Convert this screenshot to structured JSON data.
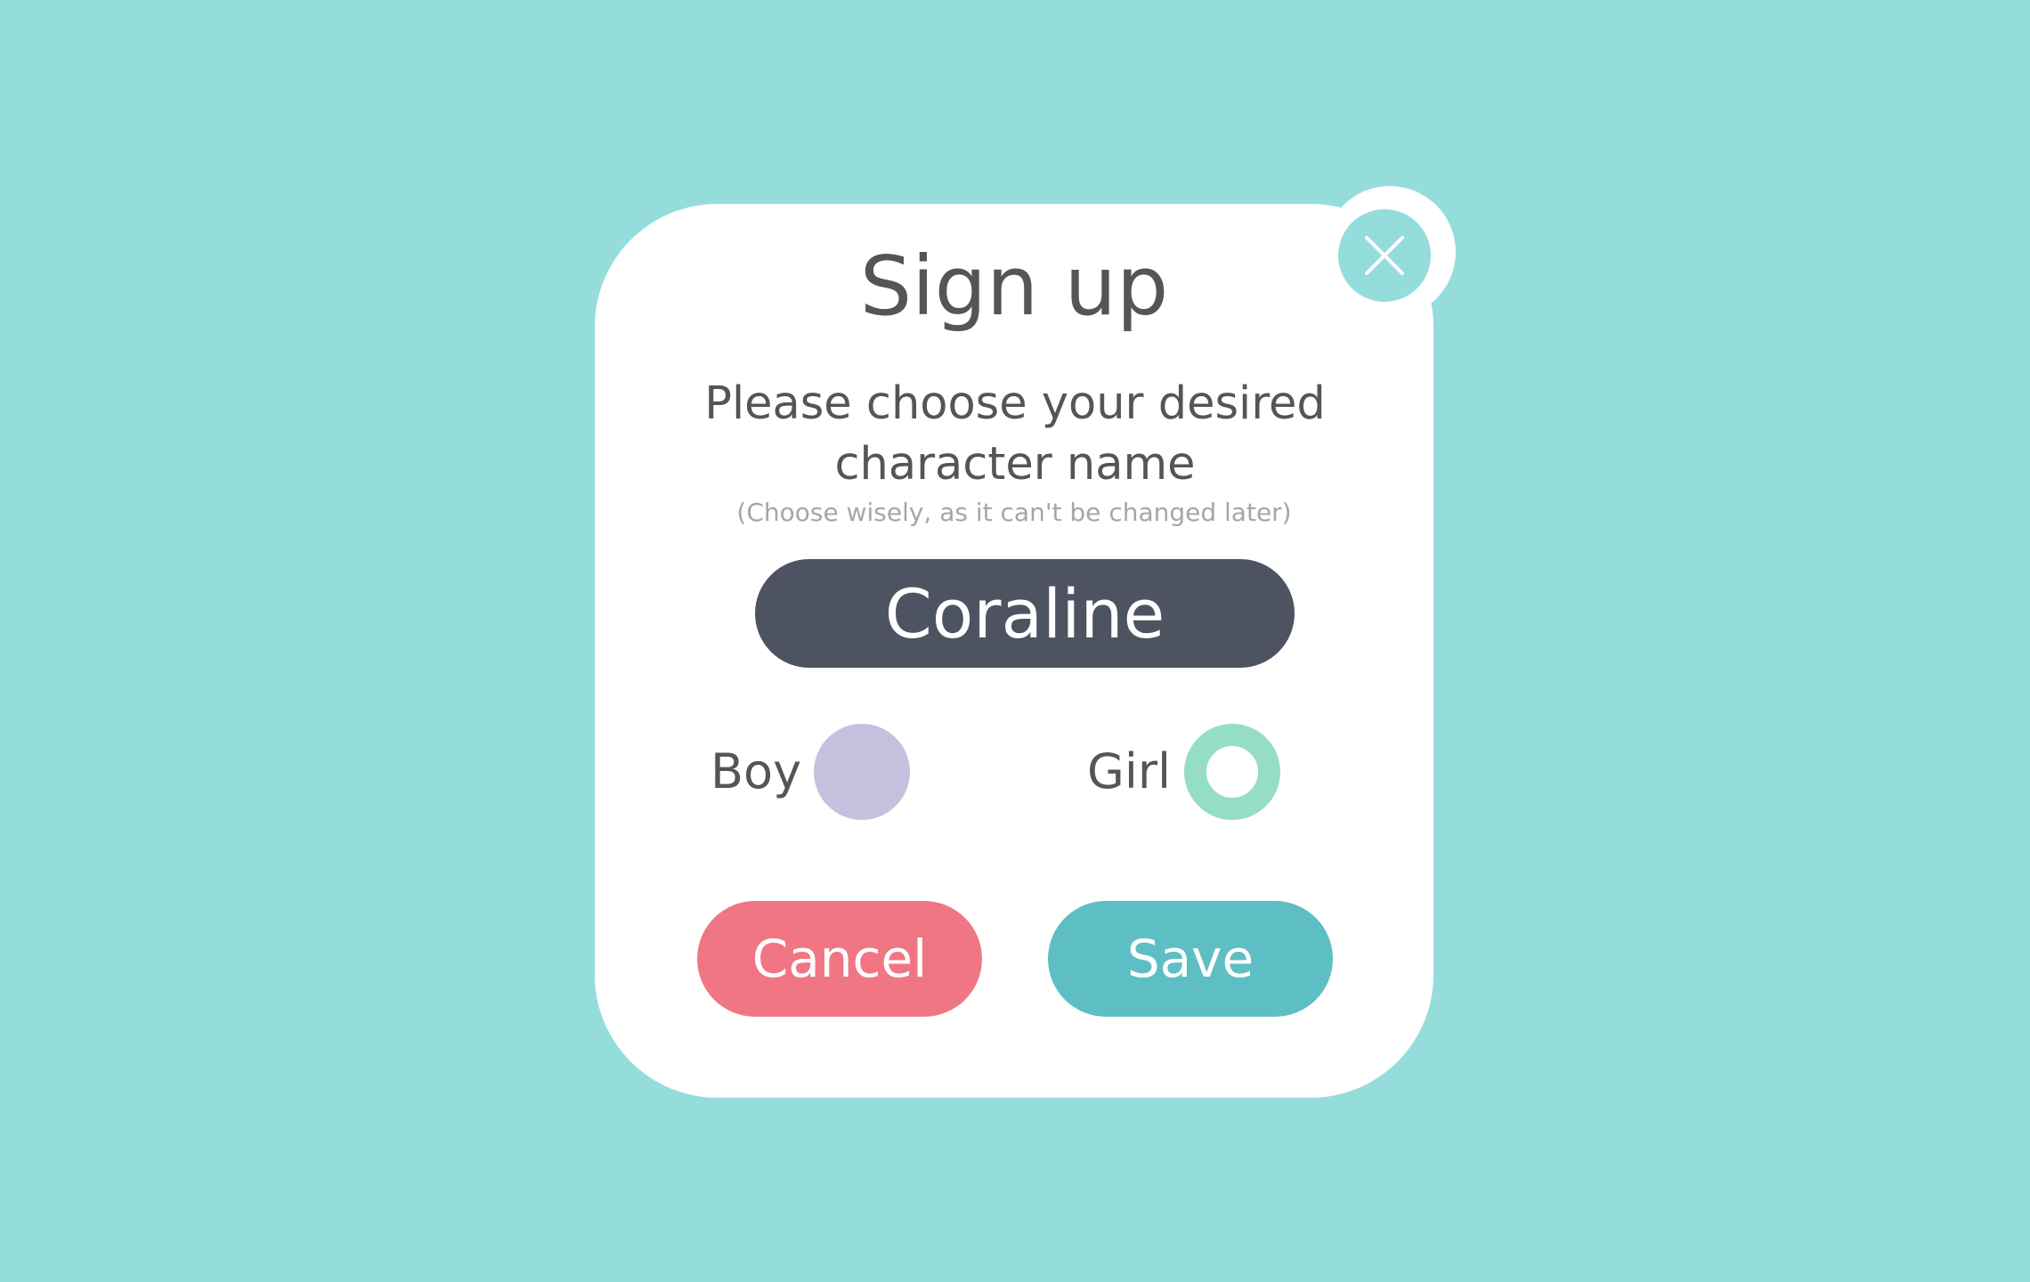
{
  "dialog": {
    "title": "Sign up",
    "prompt": "Please choose your desired character name",
    "hint": "(Choose wisely, as it can't be changed later)",
    "close_icon": "close-icon"
  },
  "name_field": {
    "value": "Coraline"
  },
  "gender": {
    "options": [
      {
        "label": "Boy",
        "color": "#c5c0de",
        "selected": false
      },
      {
        "label": "Girl",
        "color": "#96dec3",
        "selected": true
      }
    ]
  },
  "actions": {
    "cancel_label": "Cancel",
    "save_label": "Save"
  },
  "colors": {
    "background": "#94dddb",
    "dialog": "#ffffff",
    "text": "#555556",
    "hint_text": "#a6a6a6",
    "name_field": "#4e5361",
    "cancel": "#f17684",
    "save": "#5dbec3",
    "close_button": "#94dddb"
  }
}
